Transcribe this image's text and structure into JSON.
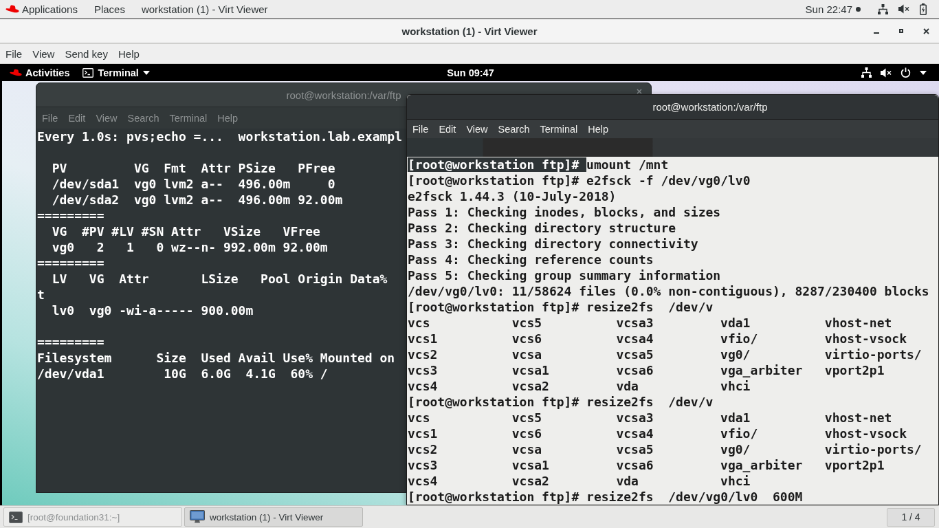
{
  "host_top_bar": {
    "menus": [
      {
        "label": "Applications"
      },
      {
        "label": "Places"
      },
      {
        "label": "workstation (1) - Virt Viewer"
      }
    ],
    "clock": "Sun 22:47"
  },
  "viewer_window": {
    "title": "workstation (1) - Virt Viewer",
    "menu": [
      "File",
      "View",
      "Send key",
      "Help"
    ]
  },
  "guest_top_bar": {
    "activities": "Activities",
    "app_menu": "Terminal",
    "clock": "Sun 09:47"
  },
  "left_terminal": {
    "title": "root@workstation:/var/ftp",
    "focused": false,
    "menu": [
      "File",
      "Edit",
      "View",
      "Search",
      "Terminal",
      "Help"
    ],
    "blocks": [
      [
        "Every 1.0s: pvs;echo =...  workstation.lab.exampl"
      ],
      [
        "  PV         VG  Fmt  Attr PSize   PFree",
        "  /dev/sda1  vg0 lvm2 a--  496.00m     0",
        "  /dev/sda2  vg0 lvm2 a--  496.00m 92.00m",
        "=========",
        "  VG  #PV #LV #SN Attr   VSize   VFree",
        "  vg0   2   1   0 wz--n- 992.00m 92.00m",
        "=========",
        "  LV   VG  Attr       LSize   Pool Origin Data%",
        "t",
        "  lv0  vg0 -wi-a----- 900.00m"
      ],
      [
        "=========",
        "Filesystem      Size  Used Avail Use% Mounted on",
        "/dev/vda1        10G  6.0G  4.1G  60% /"
      ]
    ]
  },
  "right_terminal": {
    "title": "root@workstation:/var/ftp",
    "focused": true,
    "menu": [
      "File",
      "Edit",
      "View",
      "Search",
      "Terminal",
      "Help"
    ],
    "lines": [
      {
        "kind": "prompt",
        "prompt": "[root@workstation ftp]#",
        "command": "umount /mnt",
        "highlighted": true
      },
      {
        "kind": "prompt",
        "prompt": "[root@workstation ftp]#",
        "command": "e2fsck -f /dev/vg0/lv0",
        "highlighted": false
      },
      {
        "kind": "output",
        "text": "e2fsck 1.44.3 (10-July-2018)",
        "highlighted": false
      },
      {
        "kind": "output",
        "text": "Pass 1: Checking inodes, blocks, and sizes",
        "highlighted": false
      },
      {
        "kind": "output",
        "text": "Pass 2: Checking directory structure",
        "highlighted": false
      },
      {
        "kind": "output",
        "text": "Pass 3: Checking directory connectivity",
        "highlighted": false
      },
      {
        "kind": "output",
        "text": "Pass 4: Checking reference counts",
        "highlighted": false
      },
      {
        "kind": "output",
        "text": "Pass 5: Checking group summary information",
        "highlighted": false
      },
      {
        "kind": "output",
        "text": "/dev/vg0/lv0: 11/58624 files (0.0% non-contiguous), 8287/230400 blocks",
        "highlighted": false
      },
      {
        "kind": "prompt",
        "prompt": "[root@workstation ftp]#",
        "command": "resize2fs  /dev/v",
        "highlighted": false
      },
      {
        "kind": "listing",
        "cells": [
          "vcs",
          "vcs5",
          "vcsa3",
          "vda1",
          "vhost-net"
        ],
        "highlighted": false
      },
      {
        "kind": "listing",
        "cells": [
          "vcs1",
          "vcs6",
          "vcsa4",
          "vfio/",
          "vhost-vsock"
        ],
        "highlighted": false
      },
      {
        "kind": "listing",
        "cells": [
          "vcs2",
          "vcsa",
          "vcsa5",
          "vg0/",
          "virtio-ports/"
        ],
        "highlighted": false
      },
      {
        "kind": "listing",
        "cells": [
          "vcs3",
          "vcsa1",
          "vcsa6",
          "vga_arbiter",
          "vport2p1"
        ],
        "highlighted": false
      },
      {
        "kind": "listing",
        "cells": [
          "vcs4",
          "vcsa2",
          "vda",
          "vhci"
        ],
        "highlighted": false
      },
      {
        "kind": "prompt",
        "prompt": "[root@workstation ftp]#",
        "command": "resize2fs  /dev/v",
        "highlighted": false
      },
      {
        "kind": "listing",
        "cells": [
          "vcs",
          "vcs5",
          "vcsa3",
          "vda1",
          "vhost-net"
        ],
        "highlighted": false
      },
      {
        "kind": "listing",
        "cells": [
          "vcs1",
          "vcs6",
          "vcsa4",
          "vfio/",
          "vhost-vsock"
        ],
        "highlighted": false
      },
      {
        "kind": "listing",
        "cells": [
          "vcs2",
          "vcsa",
          "vcsa5",
          "vg0/",
          "virtio-ports/"
        ],
        "highlighted": false
      },
      {
        "kind": "listing",
        "cells": [
          "vcs3",
          "vcsa1",
          "vcsa6",
          "vga_arbiter",
          "vport2p1"
        ],
        "highlighted": false
      },
      {
        "kind": "listing",
        "cells": [
          "vcs4",
          "vcsa2",
          "vda",
          "vhci"
        ],
        "highlighted": false
      },
      {
        "kind": "prompt",
        "prompt": "[root@workstation ftp]#",
        "command": "resize2fs  /dev/vg0/lv0  600M",
        "highlighted": false
      }
    ]
  },
  "taskbar": {
    "tasks": [
      {
        "kind": "terminal",
        "label": "[root@foundation31:~]",
        "minimized": true,
        "selected": false
      },
      {
        "kind": "viewer",
        "label": "workstation (1) - Virt Viewer",
        "minimized": false,
        "selected": true
      }
    ],
    "workspace": "1 / 4"
  }
}
